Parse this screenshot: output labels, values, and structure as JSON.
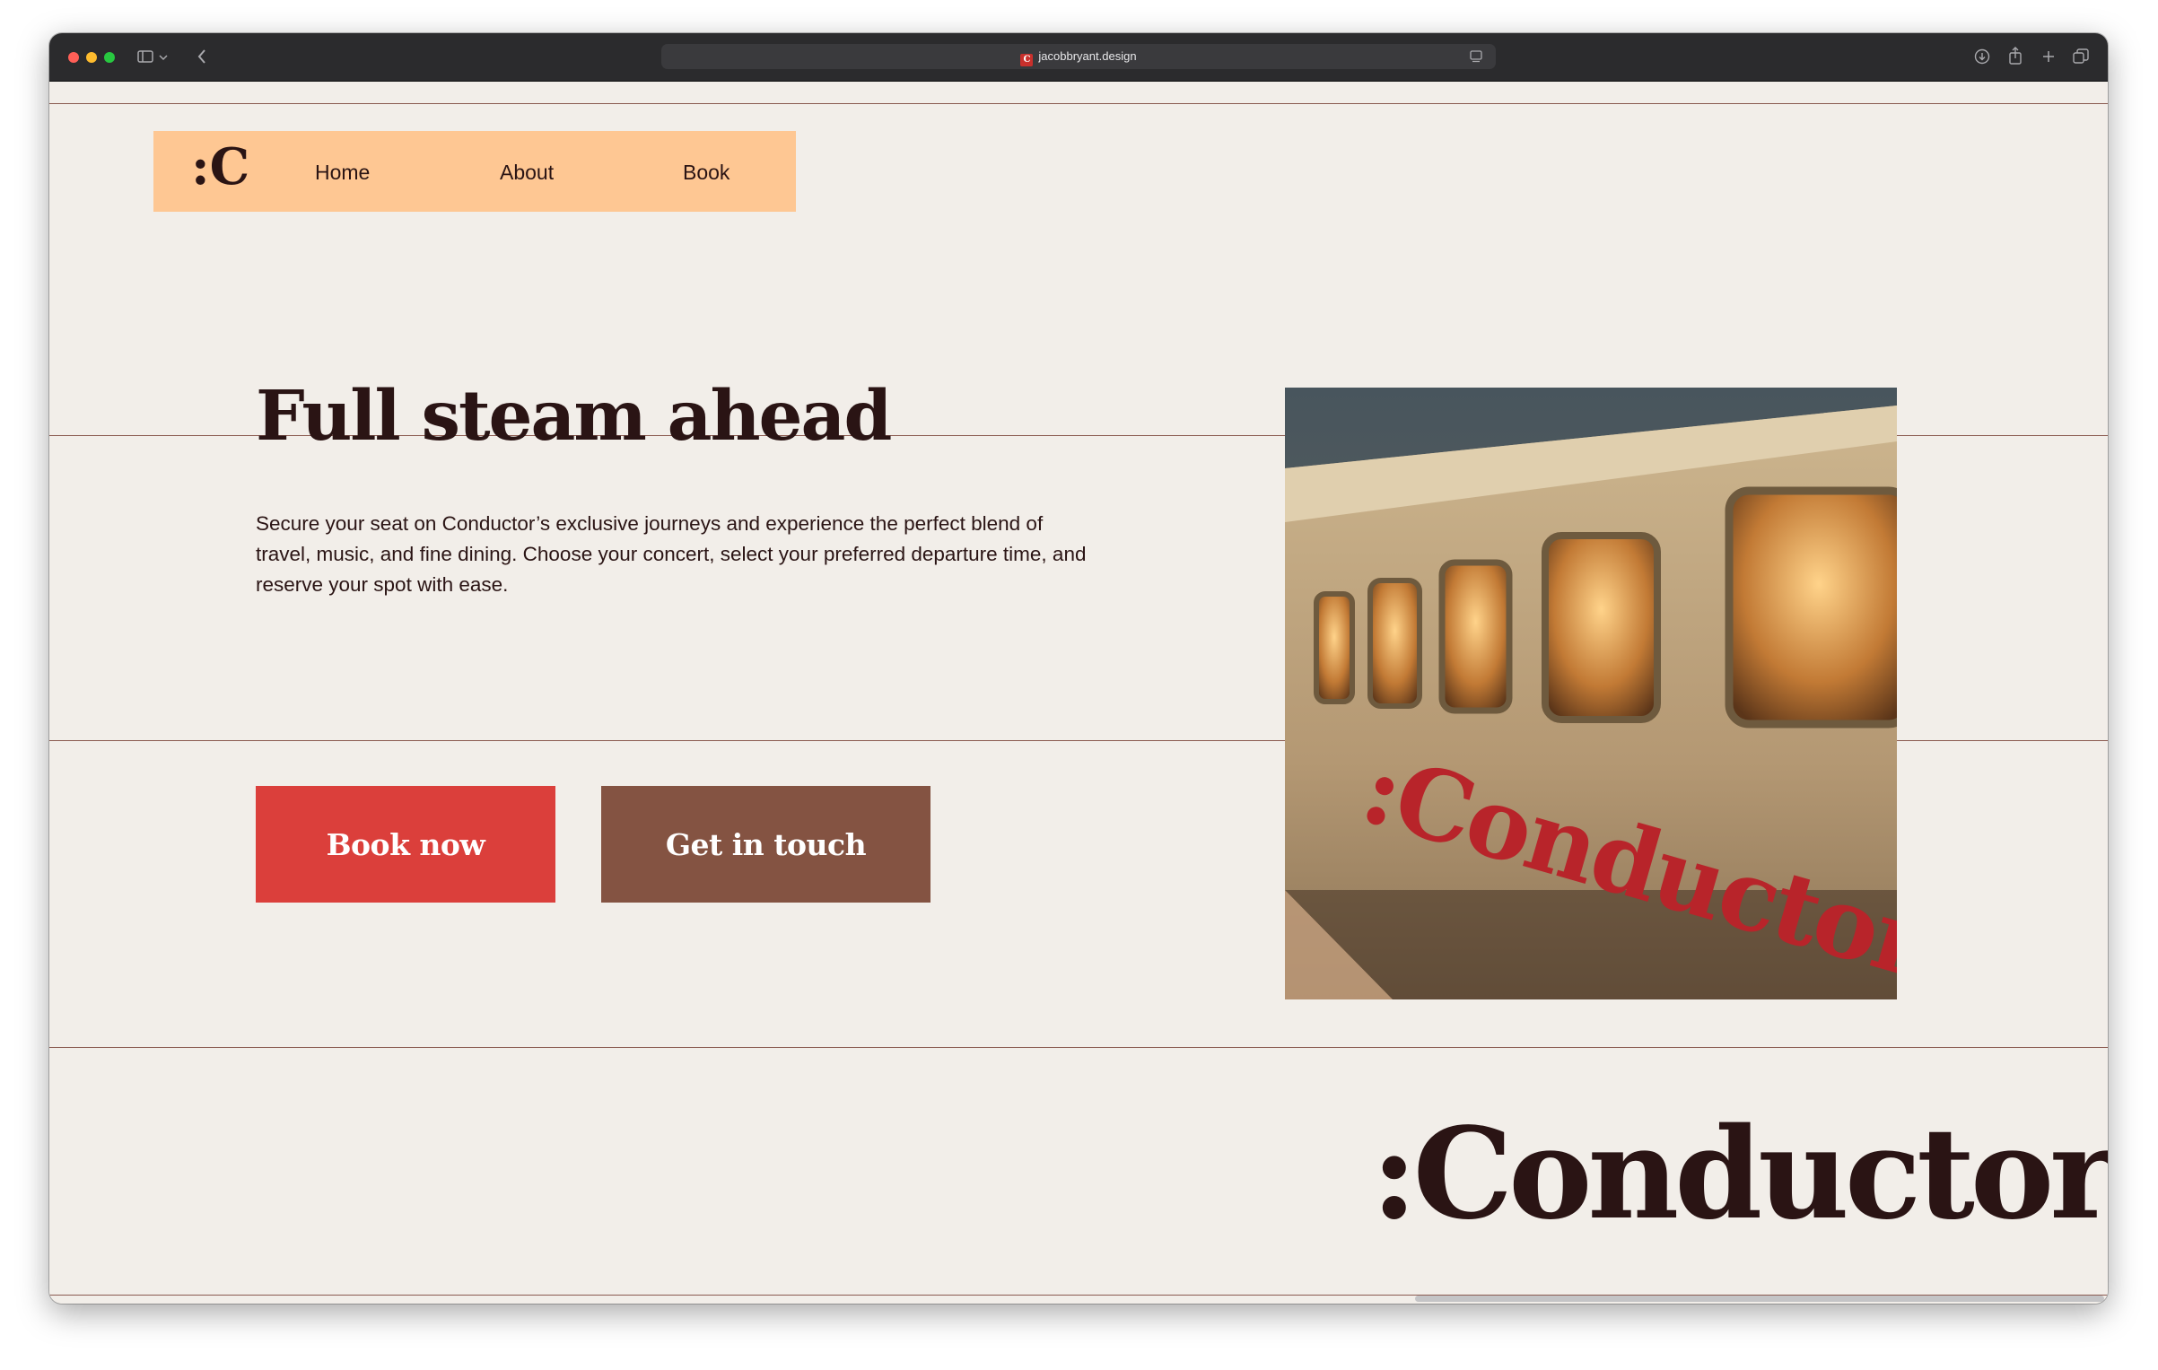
{
  "browser": {
    "url": "jacobbryant.design"
  },
  "nav": {
    "logo": ":C",
    "items": [
      {
        "label": "Home"
      },
      {
        "label": "About"
      },
      {
        "label": "Book"
      }
    ]
  },
  "hero": {
    "title": "Full steam ahead",
    "body": "Secure your seat on Conductor’s exclusive journeys and experience the perfect blend of travel, music, and fine dining. Choose your concert, select your preferred departure time, and reserve your spot with ease.",
    "primary_button": "Book now",
    "secondary_button": "Get in touch",
    "image_text": ":Conductor"
  },
  "footer": {
    "brand": ":Conductor"
  },
  "colors": {
    "background": "#f2eee9",
    "nav_background": "#fec793",
    "text": "#2a1414",
    "primary_button": "#db3f3b",
    "secondary_button": "#845342",
    "rule": "#8a5a50"
  },
  "icons": [
    "sidebar-icon",
    "chevron-down-icon",
    "back-icon",
    "reader-icon",
    "download-icon",
    "share-icon",
    "new-tab-icon",
    "tabs-overview-icon"
  ]
}
